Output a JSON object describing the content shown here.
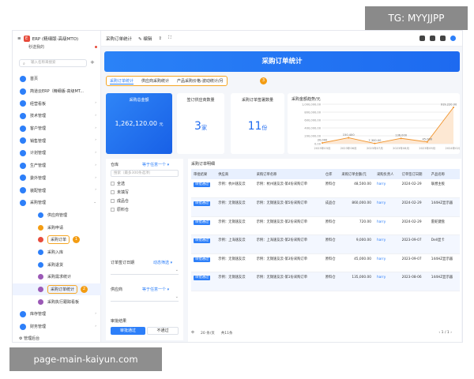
{
  "app": {
    "title": "ERP (精细版-高级MTO)",
    "user": "秒送我的",
    "search_placeholder": "输入名称来搜索"
  },
  "overlays": {
    "tg": "TG: MYYJJPP",
    "watermark": "page-main-kaiyun.com"
  },
  "sidebar": {
    "items": [
      {
        "label": "首页",
        "icon": "home-icon",
        "color": "#2d7ff9"
      },
      {
        "label": "简道云ERP（精细版-高级MT...",
        "icon": "app-icon",
        "color": "#2d7ff9"
      },
      {
        "label": "经营看板",
        "icon": "dashboard-icon",
        "color": "#2d7ff9",
        "arrow": "›"
      },
      {
        "label": "技术管理",
        "icon": "tech-icon",
        "color": "#2d7ff9",
        "arrow": "›"
      },
      {
        "label": "客户管理",
        "icon": "customer-icon",
        "color": "#2d7ff9",
        "arrow": "›"
      },
      {
        "label": "销售管理",
        "icon": "sales-icon",
        "color": "#2d7ff9",
        "arrow": "›"
      },
      {
        "label": "计划管理",
        "icon": "plan-icon",
        "color": "#2d7ff9",
        "arrow": "›"
      },
      {
        "label": "生产管理",
        "icon": "production-icon",
        "color": "#2d7ff9",
        "arrow": "›"
      },
      {
        "label": "委外管理",
        "icon": "outsource-icon",
        "color": "#2d7ff9",
        "arrow": "›"
      },
      {
        "label": "装配管理",
        "icon": "assembly-icon",
        "color": "#2d7ff9",
        "arrow": "›"
      },
      {
        "label": "采购管理",
        "icon": "purchase-icon",
        "color": "#2d7ff9",
        "arrow": "⌄"
      }
    ],
    "sub_items": [
      {
        "label": "供应商管理",
        "color": "#2d7ff9"
      },
      {
        "label": "采购申请",
        "color": "#f39c12"
      },
      {
        "label": "采购订单",
        "color": "#e74c3c",
        "badge": "1"
      },
      {
        "label": "采购入库",
        "color": "#2d7ff9"
      },
      {
        "label": "采购退货",
        "color": "#2d7ff9"
      },
      {
        "label": "采购需求统计",
        "color": "#9b59b6"
      },
      {
        "label": "采购订单统计",
        "color": "#9b59b6",
        "badge": "2"
      },
      {
        "label": "采购执行跟踪看板",
        "color": "#9b59b6"
      }
    ],
    "bottom_items": [
      {
        "label": "库存管理",
        "icon": "inventory-icon",
        "color": "#2d7ff9",
        "arrow": "›"
      },
      {
        "label": "财务管理",
        "icon": "finance-icon",
        "color": "#2d7ff9",
        "arrow": "›"
      }
    ],
    "admin": "管理后台"
  },
  "topbar": {
    "title": "采购订单统计",
    "edit": "编辑"
  },
  "main": {
    "banner": "采购订单统计",
    "tabs": [
      "采购订单统计",
      "供应商采购统计",
      "产品采购价格-波动统计/月"
    ],
    "tabs_badge": "3",
    "kpi": {
      "total_label": "采购总金额",
      "total_value": "1,262,120.00",
      "total_unit": "元",
      "supplier_label": "签订供应商数量",
      "supplier_value": "3",
      "supplier_unit": "家",
      "orders_label": "采购订单签署数量",
      "orders_value": "11",
      "orders_unit": "份"
    },
    "trend_label": "采购金额趋势/元"
  },
  "chart_data": {
    "type": "line",
    "title": "采购金额趋势/元",
    "x": [
      "2023年03月",
      "2023年06月",
      "2023年07月",
      "2023年08月",
      "2023年09月",
      "2024年02月"
    ],
    "ytick_labels": [
      "1,000,000.00",
      "800,000.00",
      "600,000.00",
      "400,000.00",
      "200,000.00",
      "0.00"
    ],
    "ylim": [
      0,
      1000000
    ],
    "series": [
      {
        "values": [
          20000,
          150400,
          7300,
          136000,
          45000,
          919220
        ]
      }
    ],
    "point_labels": [
      "20,000",
      "150,400",
      "7,300.00",
      "136,000",
      "45,000",
      "919,220.00"
    ],
    "color": "#f0932b"
  },
  "filters": {
    "warehouse_label": "仓库",
    "warehouse_mode": "等于任意一个 ▾",
    "warehouse_search": "搜索（最多300条选项）",
    "options": [
      "全选",
      "未填写",
      "成品仓",
      "原料仓"
    ],
    "date_label": "订单签订日期",
    "date_mode": "动态筛选 ▾",
    "supplier_label": "供应商",
    "supplier_mode": "等于任意一个 ▾",
    "approval_label": "审批结果",
    "approved": "审批通过",
    "rejected": "不通过"
  },
  "table": {
    "title": "采购订单明细",
    "headers": [
      "审批结果",
      "供应商",
      "采购订单名称",
      "仓库",
      "采购订单金额/元",
      "采购负责人",
      "订单签订日期",
      "产品名称"
    ],
    "rows": [
      {
        "result": "审批通过",
        "supplier": "示例：杭州速友云",
        "name": "示例：杭州速友云-第4份采购订单",
        "wh": "原料仓",
        "amount": "48,500.00",
        "owner": "harry",
        "date": "2024-02-29",
        "product": "联想主板"
      },
      {
        "result": "审批通过",
        "supplier": "示例：无锡速友云",
        "name": "示例：无锡速友云-第5份采购订单",
        "wh": "成品仓",
        "amount": "860,000.00",
        "owner": "harry",
        "date": "2024-02-29",
        "product": "144HZ显示器"
      },
      {
        "result": "审批通过",
        "supplier": "示例：无锡速友云",
        "name": "示例：无锡速友云-第2份采购订单",
        "wh": "原料仓",
        "amount": "720.00",
        "owner": "harry",
        "date": "2024-02-29",
        "product": "雷蛇键盘"
      },
      {
        "result": "审批通过",
        "supplier": "示例：上海速友云",
        "name": "示例：上海速友云-第2份采购订单",
        "wh": "原料仓",
        "amount": "9,000.00",
        "owner": "harry",
        "date": "2023-09-07",
        "product": "Dell显卡"
      },
      {
        "result": "审批通过",
        "supplier": "示例：无锡速友云",
        "name": "示例：无锡速友云-第3份采购订单",
        "wh": "原料仓",
        "amount": "45,000.00",
        "owner": "harry",
        "date": "2023-09-07",
        "product": "144HZ显示器"
      },
      {
        "result": "审批通过",
        "supplier": "示例：无锡速友云",
        "name": "示例：无锡速友云-第1份采购订单",
        "wh": "原料仓",
        "amount": "135,000.00",
        "owner": "harry",
        "date": "2023-08-06",
        "product": "144HZ显示器"
      }
    ],
    "pager": {
      "size": "20 条/页",
      "total": "共11条",
      "page": "1",
      "of": "/ 1"
    }
  }
}
